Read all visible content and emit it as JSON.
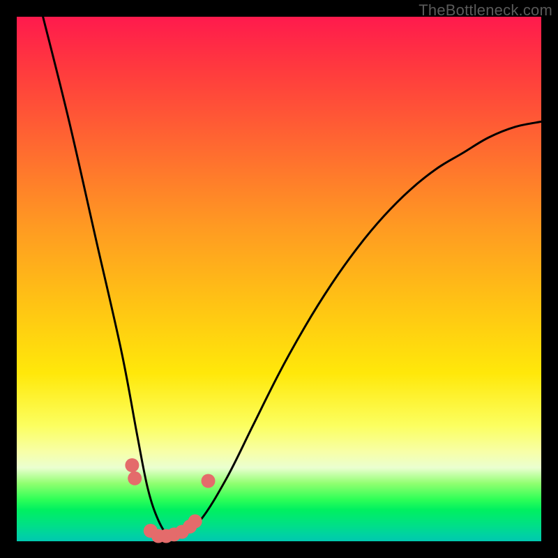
{
  "watermark": "TheBottleneck.com",
  "chart_data": {
    "type": "line",
    "title": "",
    "xlabel": "",
    "ylabel": "",
    "xlim": [
      0,
      100
    ],
    "ylim": [
      0,
      100
    ],
    "grid": false,
    "series": [
      {
        "name": "bottleneck-curve",
        "x": [
          5,
          10,
          15,
          20,
          23,
          25,
          27,
          29,
          31,
          35,
          40,
          45,
          50,
          55,
          60,
          65,
          70,
          75,
          80,
          85,
          90,
          95,
          100
        ],
        "values": [
          100,
          80,
          58,
          36,
          20,
          10,
          4,
          1,
          1,
          4,
          12,
          22,
          32,
          41,
          49,
          56,
          62,
          67,
          71,
          74,
          77,
          79,
          80
        ]
      }
    ],
    "markers": [
      {
        "x": 22.0,
        "y": 14.5
      },
      {
        "x": 22.5,
        "y": 12.0
      },
      {
        "x": 25.5,
        "y": 2.0
      },
      {
        "x": 27.0,
        "y": 1.0
      },
      {
        "x": 28.5,
        "y": 1.0
      },
      {
        "x": 30.0,
        "y": 1.3
      },
      {
        "x": 31.5,
        "y": 1.8
      },
      {
        "x": 33.0,
        "y": 2.8
      },
      {
        "x": 34.0,
        "y": 3.8
      },
      {
        "x": 36.5,
        "y": 11.5
      }
    ],
    "marker_style": {
      "color": "#e46b6b",
      "radius_px": 10
    }
  }
}
